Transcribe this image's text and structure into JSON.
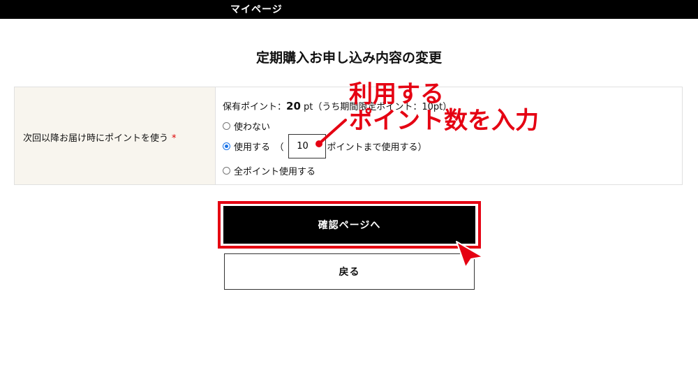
{
  "header": {
    "title": "マイページ"
  },
  "page": {
    "title": "定期購入お申し込み内容の変更"
  },
  "form": {
    "label": "次回以降お届け時にポイントを使う",
    "required_mark": "*",
    "points_prefix": "保有ポイント：",
    "points_value": "20",
    "points_unit": " pt（うち期間限定ポイント：10pt）",
    "options": {
      "no_use": "使わない",
      "use_prefix": "使用する　（",
      "use_suffix": "ポイントまで使用する）",
      "use_all": "全ポイント使用する"
    },
    "selected_option": "使用する",
    "points_input_value": "10"
  },
  "buttons": {
    "confirm": "確認ページへ",
    "back": "戻る"
  },
  "annotation": {
    "line1": "利用する",
    "line2": "ポイント数を入力",
    "color": "#e50012"
  }
}
